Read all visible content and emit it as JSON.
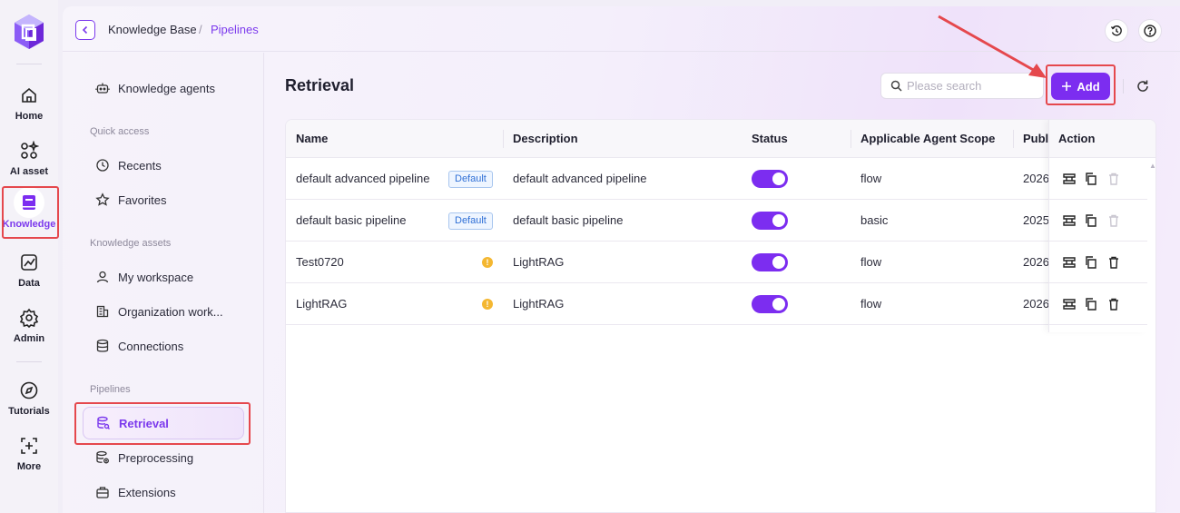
{
  "rail": {
    "items": [
      {
        "label": "Home",
        "icon": "home-icon"
      },
      {
        "label": "AI asset",
        "icon": "ai-asset-icon"
      },
      {
        "label": "Knowledge",
        "icon": "book-icon",
        "active": true
      },
      {
        "label": "Data",
        "icon": "chart-icon"
      },
      {
        "label": "Admin",
        "icon": "gear-icon"
      },
      {
        "label": "Tutorials",
        "icon": "compass-icon"
      },
      {
        "label": "More",
        "icon": "plus-square-icon"
      }
    ]
  },
  "breadcrumb": {
    "root": "Knowledge Base",
    "separator": "/",
    "current": "Pipelines"
  },
  "sidebar": {
    "top_item": "Knowledge agents",
    "sections": {
      "quick_access": "Quick access",
      "knowledge_assets": "Knowledge assets",
      "pipelines": "Pipelines"
    },
    "quick_access_items": [
      "Recents",
      "Favorites"
    ],
    "asset_items": [
      "My workspace",
      "Organization work...",
      "Connections"
    ],
    "pipeline_items": [
      "Retrieval",
      "Preprocessing",
      "Extensions"
    ]
  },
  "page": {
    "title": "Retrieval",
    "search_placeholder": "Please search",
    "add_label": "Add"
  },
  "table": {
    "headers": {
      "name": "Name",
      "description": "Description",
      "status": "Status",
      "scope": "Applicable Agent Scope",
      "published": "Publi",
      "action": "Action"
    },
    "rows": [
      {
        "name": "default advanced pipeline",
        "tag": "Default",
        "description": "default advanced pipeline",
        "status": true,
        "scope": "flow",
        "published": "2026",
        "deletable": false
      },
      {
        "name": "default basic pipeline",
        "tag": "Default",
        "description": "default basic pipeline",
        "status": true,
        "scope": "basic",
        "published": "2025",
        "deletable": false
      },
      {
        "name": "Test0720",
        "warning": "!",
        "description": "LightRAG",
        "status": true,
        "scope": "flow",
        "published": "2026",
        "deletable": true
      },
      {
        "name": "LightRAG",
        "warning": "!",
        "description": "LightRAG",
        "status": true,
        "scope": "flow",
        "published": "2026",
        "deletable": true
      }
    ]
  },
  "colors": {
    "accent": "#7c2df0",
    "highlight_box": "#e5484d",
    "badge_blue": "#2f6fd6",
    "warning": "#f4b731"
  }
}
